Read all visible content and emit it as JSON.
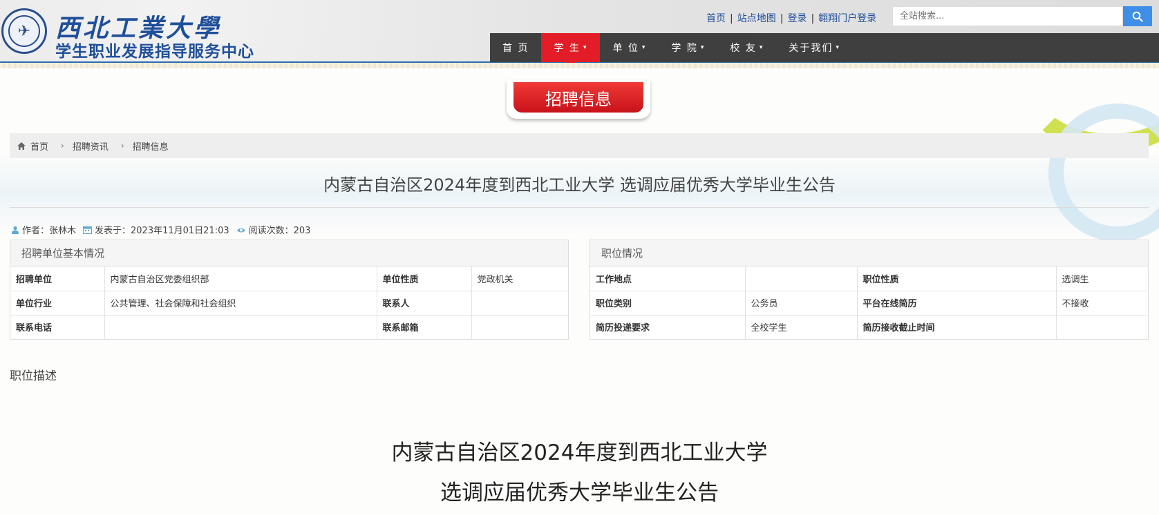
{
  "header": {
    "brand_line1": "西北工業大學",
    "brand_line2": "学生职业发展指导服务中心",
    "top_links": [
      "首页",
      "站点地图",
      "登录",
      "翱翔门户登录"
    ],
    "search_placeholder": "全站搜索..."
  },
  "nav": {
    "items": [
      {
        "label": "首 页",
        "has_caret": false,
        "active": false
      },
      {
        "label": "学 生",
        "has_caret": true,
        "active": true
      },
      {
        "label": "单 位",
        "has_caret": true,
        "active": false
      },
      {
        "label": "学 院",
        "has_caret": true,
        "active": false
      },
      {
        "label": "校 友",
        "has_caret": true,
        "active": false
      },
      {
        "label": "关于我们",
        "has_caret": true,
        "active": false
      }
    ],
    "active_color": "#e21d27"
  },
  "section_title": "招聘信息",
  "breadcrumb": [
    "首页",
    "招聘资讯",
    "招聘信息"
  ],
  "article": {
    "title": "内蒙古自治区2024年度到西北工业大学 选调应届优秀大学毕业生公告",
    "author_label": "作者：张林木",
    "published_label": "发表于：2023年11月01日21:03",
    "views_label": "阅读次数：203"
  },
  "unit_panel": {
    "heading": "招聘单位基本情况",
    "rows": [
      [
        "招聘单位",
        "内蒙古自治区党委组织部",
        "单位性质",
        "党政机关"
      ],
      [
        "单位行业",
        "公共管理、社会保障和社会组织",
        "联系人",
        ""
      ],
      [
        "联系电话",
        "",
        "联系邮箱",
        ""
      ]
    ]
  },
  "position_panel": {
    "heading": "职位情况",
    "rows": [
      [
        "工作地点",
        "",
        "职位性质",
        "选调生"
      ],
      [
        "职位类别",
        "公务员",
        "平台在线简历",
        "不接收"
      ],
      [
        "简历投递要求",
        "全校学生",
        "简历接收截止时间",
        ""
      ]
    ]
  },
  "description": {
    "label": "职位描述",
    "title_line1": "内蒙古自治区2024年度到西北工业大学",
    "title_line2": "选调应届优秀大学毕业生公告"
  },
  "icons": [
    "home-icon",
    "user-icon",
    "calendar-icon",
    "eye-icon",
    "search-icon",
    "chevron-down-icon",
    "chevron-right-icon"
  ]
}
